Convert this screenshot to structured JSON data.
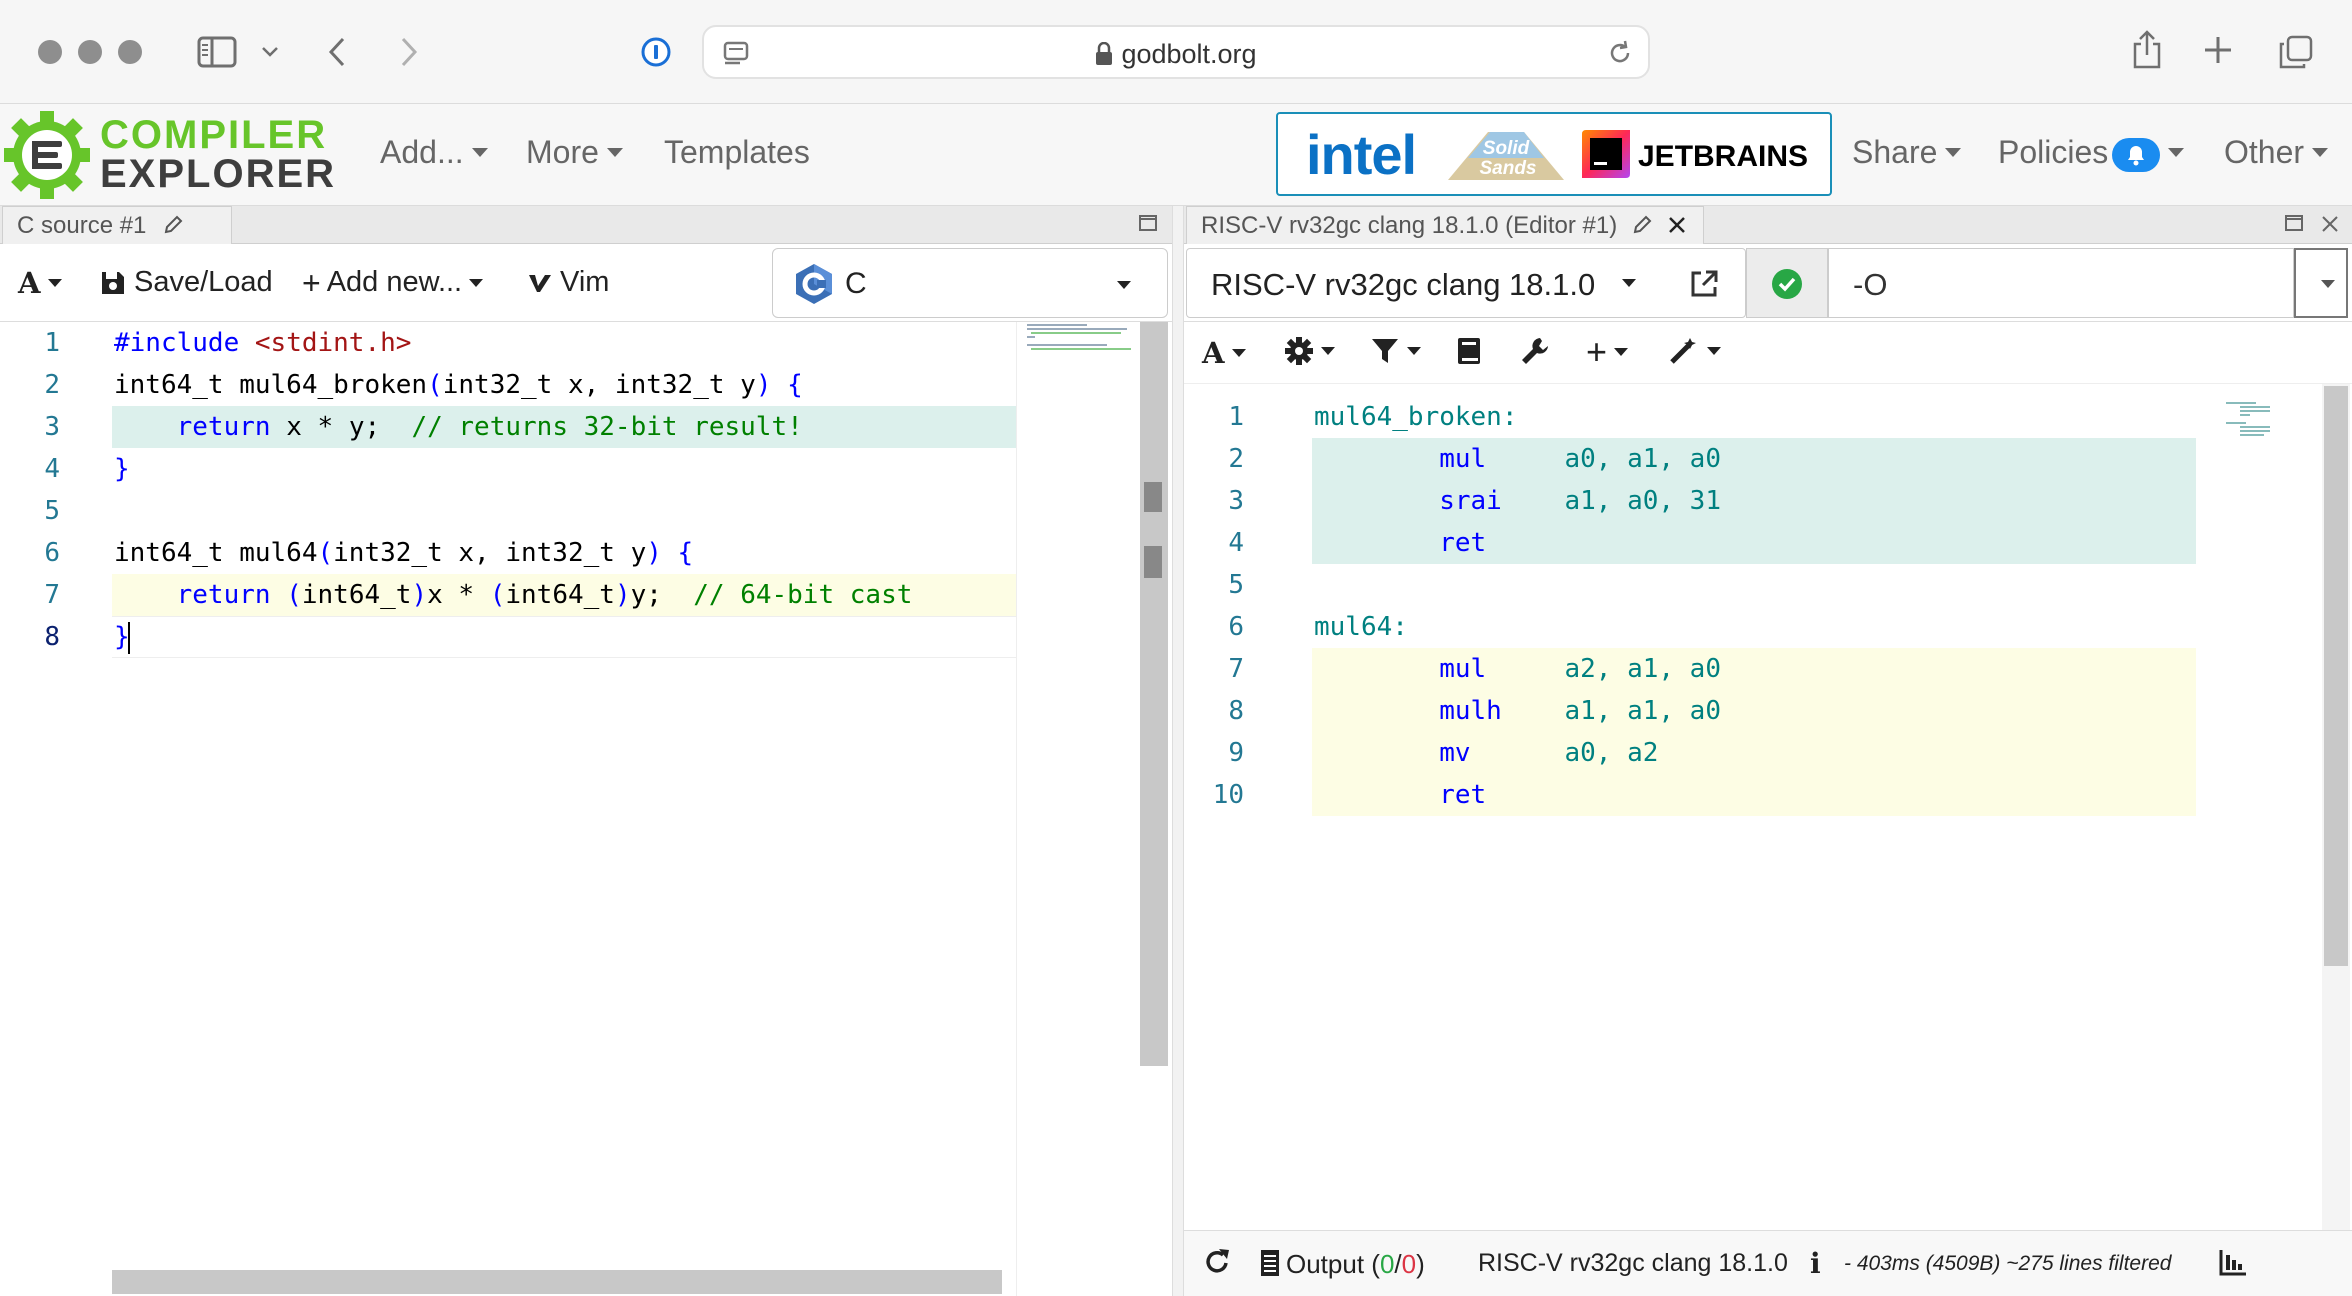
{
  "browser": {
    "url": "godbolt.org",
    "colors": {
      "chrome_bg": "#f6f6f6",
      "icon": "#6f6f6f"
    }
  },
  "navbar": {
    "logo_line1": "COMPILER",
    "logo_line2": "EXPLORER",
    "menu": {
      "add": "Add...",
      "more": "More",
      "templates": "Templates"
    },
    "sponsors": {
      "intel": "intel",
      "solid_line1": "Solid",
      "solid_line2": "Sands",
      "jetbrains": "JETBRAINS"
    },
    "right": {
      "share": "Share",
      "policies": "Policies",
      "other": "Other"
    },
    "colors": {
      "logo_green": "#67c52a",
      "sponsor_border": "#1a8fb8",
      "badge_blue": "#1a8cf0"
    }
  },
  "source_pane": {
    "tab_title": "C source #1",
    "toolbar": {
      "font_button": "A",
      "save_load": "Save/Load",
      "add_new": "Add new...",
      "vim": "Vim",
      "language": "C"
    },
    "line_numbers": [
      "1",
      "2",
      "3",
      "4",
      "5",
      "6",
      "7",
      "8"
    ],
    "lines": [
      {
        "tokens": [
          {
            "t": "#include ",
            "c": "kw"
          },
          {
            "t": "<stdint.h>",
            "c": "str"
          }
        ]
      },
      {
        "tokens": [
          {
            "t": "int64_t mul64_broken",
            "c": "tx"
          },
          {
            "t": "(",
            "c": "kw"
          },
          {
            "t": "int32_t x, int32_t y",
            "c": "tx"
          },
          {
            "t": ") {",
            "c": "kw"
          }
        ]
      },
      {
        "tokens": [
          {
            "t": "    return",
            "c": "kw"
          },
          {
            "t": " x * y;  ",
            "c": "tx"
          },
          {
            "t": "// returns 32-bit result!",
            "c": "cmt"
          }
        ],
        "highlight": "#dcf0ec"
      },
      {
        "tokens": [
          {
            "t": "}",
            "c": "kw"
          }
        ]
      },
      {
        "tokens": []
      },
      {
        "tokens": [
          {
            "t": "int64_t mul64",
            "c": "tx"
          },
          {
            "t": "(",
            "c": "kw"
          },
          {
            "t": "int32_t x, int32_t y",
            "c": "tx"
          },
          {
            "t": ") {",
            "c": "kw"
          }
        ]
      },
      {
        "tokens": [
          {
            "t": "    return",
            "c": "kw"
          },
          {
            "t": " ",
            "c": "tx"
          },
          {
            "t": "(",
            "c": "kw"
          },
          {
            "t": "int64_t",
            "c": "tx"
          },
          {
            "t": ")",
            "c": "kw"
          },
          {
            "t": "x * ",
            "c": "tx"
          },
          {
            "t": "(",
            "c": "kw"
          },
          {
            "t": "int64_t",
            "c": "tx"
          },
          {
            "t": ")",
            "c": "kw"
          },
          {
            "t": "y;  ",
            "c": "tx"
          },
          {
            "t": "// 64-bit cast",
            "c": "cmt"
          }
        ],
        "highlight": "#fdfde4"
      },
      {
        "tokens": [
          {
            "t": "}",
            "c": "kw"
          }
        ]
      }
    ],
    "colors": {
      "line_highlight_1": "#dcf0ec",
      "line_highlight_2": "#fdfde4"
    }
  },
  "compiler_pane": {
    "tab_title": "RISC-V rv32gc clang 18.1.0 (Editor #1)",
    "compiler_name": "RISC-V rv32gc clang 18.1.0",
    "options": "-O",
    "line_numbers": [
      "1",
      "2",
      "3",
      "4",
      "5",
      "6",
      "7",
      "8",
      "9",
      "10"
    ],
    "lines": [
      {
        "tokens": [
          {
            "t": "mul64_broken:",
            "c": "asm-lbl"
          }
        ]
      },
      {
        "tokens": [
          {
            "t": "        mul     ",
            "c": "asm-ins"
          },
          {
            "t": "a0, a1, a0",
            "c": "asm-reg"
          }
        ],
        "highlight": "#dcf0ec"
      },
      {
        "tokens": [
          {
            "t": "        srai    ",
            "c": "asm-ins"
          },
          {
            "t": "a1, a0, 31",
            "c": "asm-reg"
          }
        ],
        "highlight": "#dcf0ec"
      },
      {
        "tokens": [
          {
            "t": "        ret",
            "c": "asm-ins"
          }
        ],
        "highlight": "#dcf0ec"
      },
      {
        "tokens": []
      },
      {
        "tokens": [
          {
            "t": "mul64:",
            "c": "asm-lbl"
          }
        ]
      },
      {
        "tokens": [
          {
            "t": "        mul     ",
            "c": "asm-ins"
          },
          {
            "t": "a2, a1, a0",
            "c": "asm-reg"
          }
        ],
        "highlight": "#fdfde4"
      },
      {
        "tokens": [
          {
            "t": "        mulh    ",
            "c": "asm-ins"
          },
          {
            "t": "a1, a1, a0",
            "c": "asm-reg"
          }
        ],
        "highlight": "#fdfde4"
      },
      {
        "tokens": [
          {
            "t": "        mv      ",
            "c": "asm-ins"
          },
          {
            "t": "a0, a2",
            "c": "asm-reg"
          }
        ],
        "highlight": "#fdfde4"
      },
      {
        "tokens": [
          {
            "t": "        ret",
            "c": "asm-ins"
          }
        ],
        "highlight": "#fdfde4"
      }
    ],
    "status": {
      "output_label": "Output (",
      "output_ok": "0",
      "output_sep": "/",
      "output_err": "0",
      "output_close": ")",
      "compiler": "RISC-V rv32gc clang 18.1.0",
      "info_icon": "i",
      "stats": "- 403ms (4509B) ~275 lines filtered"
    },
    "colors": {
      "success_green": "#28a745",
      "ok_count": "#28a745",
      "err_count": "#dc3545"
    }
  }
}
